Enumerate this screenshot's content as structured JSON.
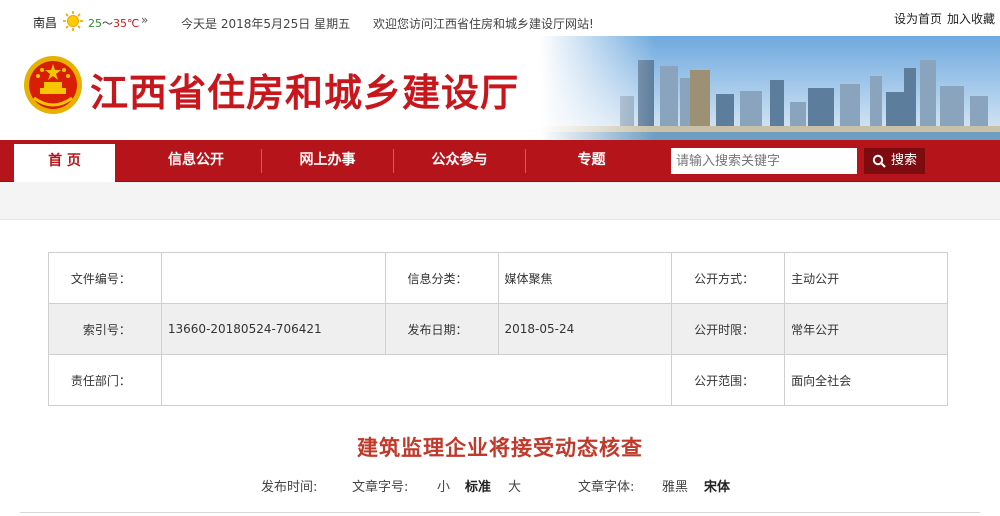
{
  "topbar": {
    "city": "南昌",
    "weather_icon": "sun-icon",
    "temp_low": "25",
    "temp_sep": "～",
    "temp_high": "35℃",
    "more_glyph": "»",
    "date": "今天是 2018年5月25日 星期五",
    "welcome": "欢迎您访问江西省住房和城乡建设厅网站!",
    "set_home": "设为首页",
    "favorite": "加入收藏"
  },
  "banner": {
    "title": "江西省住房和城乡建设厅",
    "emblem_icon": "national-emblem-icon"
  },
  "nav": {
    "items": [
      "首 页",
      "信息公开",
      "网上办事",
      "公众参与",
      "专题"
    ],
    "search_placeholder": "请输入搜索关键字",
    "search_button": "搜索"
  },
  "colors": {
    "brand_red": "#b5141b",
    "title_red": "#c8161d",
    "article_title": "#c0392b"
  },
  "info": {
    "doc_no_label": "文件编号：",
    "doc_no": "",
    "category_label": "信息分类：",
    "category": "媒体聚焦",
    "open_mode_label": "公开方式：",
    "open_mode": "主动公开",
    "index_label": "索引号：",
    "index": "13660-20180524-706421",
    "pub_date_label": "发布日期：",
    "pub_date": "2018-05-24",
    "open_term_label": "公开时限：",
    "open_term": "常年公开",
    "dept_label": "责任部门：",
    "dept": "",
    "open_scope_label": "公开范围：",
    "open_scope": "面向全社会"
  },
  "article": {
    "title": "建筑监理企业将接受动态核查",
    "pub_time_label": "发布时间:",
    "font_size_label": "文章字号:",
    "size_small": "小",
    "size_standard": "标准",
    "size_large": "大",
    "font_face_label": "文章字体:",
    "face_yahei": "雅黑",
    "face_song": "宋体"
  }
}
